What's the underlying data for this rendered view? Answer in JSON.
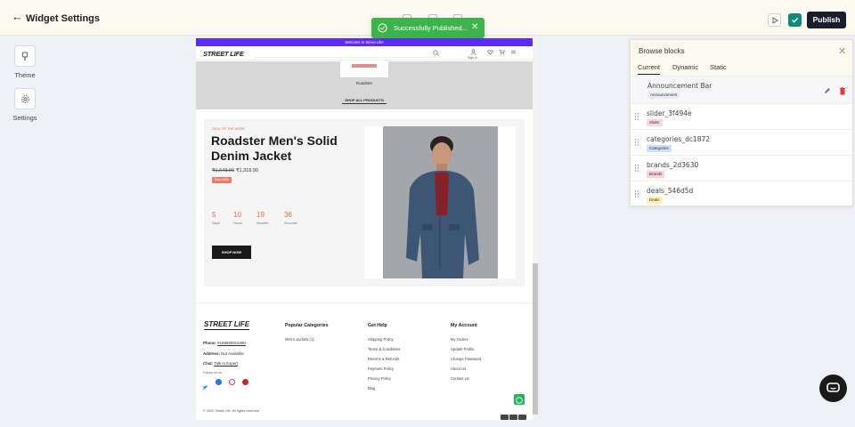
{
  "header": {
    "back_icon": "arrow-left-icon",
    "title": "Widget Settings",
    "publish_label": "Publish",
    "check_color": "#10897b"
  },
  "toast": {
    "message": "Successfully Published...",
    "color": "#3cb44b",
    "close_glyph": "✕"
  },
  "rail": {
    "items": [
      {
        "label": "Theme",
        "icon": "brush-icon"
      },
      {
        "label": "Settings",
        "icon": "gear-icon"
      }
    ]
  },
  "preview": {
    "announcement": "Welcome to Street Life!",
    "announcement_color": "#5b2cf5",
    "brand": "STREET LIFE",
    "signin": "Sign In",
    "category_card_label": "Roadster",
    "shop_all": "SHOP ALL PRODUCTS",
    "deal": {
      "kicker": "DEAL OF THE WEEK",
      "title": "Roadster Men's Solid Denim Jacket",
      "price_old": "₹1,648.90",
      "price_new": "₹1,318.90",
      "badge": "Save 20%",
      "countdown": [
        {
          "value": "5",
          "label": "Days"
        },
        {
          "value": "10",
          "label": "Hours"
        },
        {
          "value": "19",
          "label": "Minutes"
        },
        {
          "value": "36",
          "label": "Seconds"
        }
      ],
      "cta": "SHOP NOW"
    },
    "footer": {
      "logo": "STREET LIFE",
      "phone_label": "Phone:",
      "phone": "9198690918490",
      "address_label": "Address:",
      "address": "Not Available",
      "chat_label": "Chat:",
      "chat": "Talk to Expert",
      "follow": "Follow us on",
      "columns": [
        {
          "heading": "Popular Categories",
          "links": [
            "Men's Jackets (1)"
          ]
        },
        {
          "heading": "Get Help",
          "links": [
            "Shipping Policy",
            "Terms & Conditions",
            "Returns & Refunds",
            "Payment Policy",
            "Privacy Policy",
            "Blog"
          ]
        },
        {
          "heading": "My Account",
          "links": [
            "My Orders",
            "Update Profile",
            "Change Password",
            "About Us",
            "Contact Us"
          ]
        }
      ],
      "copyright": "© 2022 Street Life. All rights reserved"
    }
  },
  "panel": {
    "title": "Browse blocks",
    "tabs": [
      "Current",
      "Dynamic",
      "Static"
    ],
    "active_tab": "Current",
    "blocks": [
      {
        "name": "Announcement Bar",
        "tag": "Announcement",
        "tag_color": "#e9ecf2"
      },
      {
        "name": "slider_3f494e",
        "tag": "Slider",
        "tag_color": "#fbd5e3"
      },
      {
        "name": "categories_dc1872",
        "tag": "Categories",
        "tag_color": "#cfe0fb"
      },
      {
        "name": "brands_2d3630",
        "tag": "Brands",
        "tag_color": "#fbd0d8"
      },
      {
        "name": "deals_546d5d",
        "tag": "Deals",
        "tag_color": "#fcefb4"
      }
    ]
  }
}
